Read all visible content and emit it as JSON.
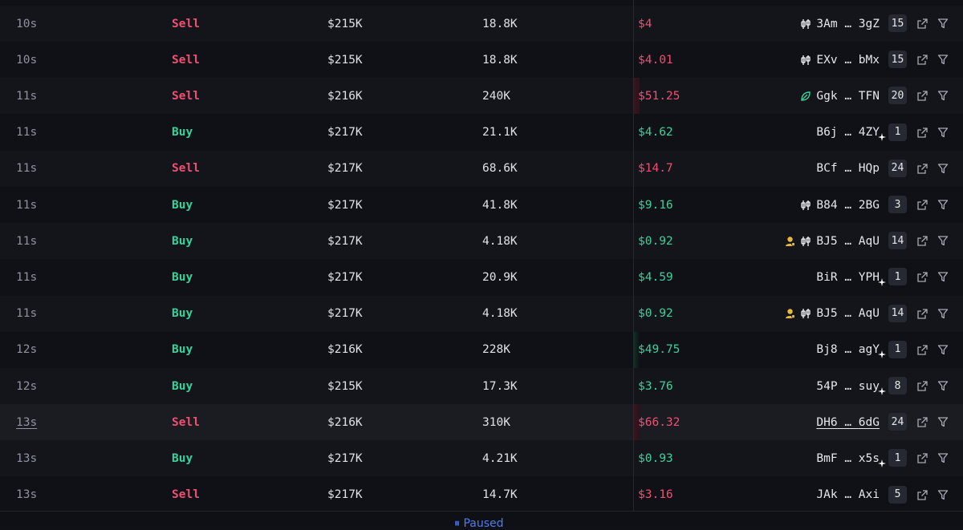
{
  "colors": {
    "buy": "#37d39b",
    "sell": "#ef4f72",
    "background": "#101116"
  },
  "rows": [
    {
      "age": "10s",
      "type": "Sell",
      "mc": "$215K",
      "amount": "18.8K",
      "total": "$4",
      "maker_prefix": "3Am",
      "maker_suffix": "3gZ",
      "count": "15",
      "icons": [
        "candle-icon"
      ],
      "bar": 0
    },
    {
      "age": "10s",
      "type": "Sell",
      "mc": "$215K",
      "amount": "18.8K",
      "total": "$4.01",
      "maker_prefix": "EXv",
      "maker_suffix": "bMx",
      "count": "15",
      "icons": [
        "candle-icon"
      ],
      "bar": 0
    },
    {
      "age": "11s",
      "type": "Sell",
      "mc": "$216K",
      "amount": "240K",
      "total": "$51.25",
      "maker_prefix": "Ggk",
      "maker_suffix": "TFN",
      "count": "20",
      "icons": [
        "leaf-icon"
      ],
      "bar": 0.011
    },
    {
      "age": "11s",
      "type": "Buy",
      "mc": "$217K",
      "amount": "21.1K",
      "total": "$4.62",
      "maker_prefix": "B6j",
      "maker_suffix": "4ZY",
      "count": "1",
      "icons": [
        "sparkle-icon"
      ],
      "bar": 0
    },
    {
      "age": "11s",
      "type": "Sell",
      "mc": "$217K",
      "amount": "68.6K",
      "total": "$14.7",
      "maker_prefix": "BCf",
      "maker_suffix": "HQp",
      "count": "24",
      "icons": [],
      "bar": 0
    },
    {
      "age": "11s",
      "type": "Buy",
      "mc": "$217K",
      "amount": "41.8K",
      "total": "$9.16",
      "maker_prefix": "B84",
      "maker_suffix": "2BG",
      "count": "3",
      "icons": [
        "candle-icon"
      ],
      "bar": 0
    },
    {
      "age": "11s",
      "type": "Buy",
      "mc": "$217K",
      "amount": "4.18K",
      "total": "$0.92",
      "maker_prefix": "BJ5",
      "maker_suffix": "AqU",
      "count": "14",
      "icons": [
        "user-icon",
        "candle-icon"
      ],
      "bar": 0
    },
    {
      "age": "11s",
      "type": "Buy",
      "mc": "$217K",
      "amount": "20.9K",
      "total": "$4.59",
      "maker_prefix": "BiR",
      "maker_suffix": "YPH",
      "count": "1",
      "icons": [
        "sparkle-icon"
      ],
      "bar": 0
    },
    {
      "age": "11s",
      "type": "Buy",
      "mc": "$217K",
      "amount": "4.18K",
      "total": "$0.92",
      "maker_prefix": "BJ5",
      "maker_suffix": "AqU",
      "count": "14",
      "icons": [
        "user-icon",
        "candle-icon"
      ],
      "bar": 0
    },
    {
      "age": "12s",
      "type": "Buy",
      "mc": "$216K",
      "amount": "228K",
      "total": "$49.75",
      "maker_prefix": "Bj8",
      "maker_suffix": "agY",
      "count": "1",
      "icons": [
        "sparkle-icon"
      ],
      "bar": 0.011
    },
    {
      "age": "12s",
      "type": "Buy",
      "mc": "$215K",
      "amount": "17.3K",
      "total": "$3.76",
      "maker_prefix": "54P",
      "maker_suffix": "suy",
      "count": "8",
      "icons": [
        "sparkle-icon"
      ],
      "bar": 0
    },
    {
      "age": "13s",
      "type": "Sell",
      "mc": "$216K",
      "amount": "310K",
      "total": "$66.32",
      "maker_prefix": "DH6",
      "maker_suffix": "6dG",
      "count": "24",
      "icons": [],
      "bar": 0.02,
      "highlight": true
    },
    {
      "age": "13s",
      "type": "Buy",
      "mc": "$217K",
      "amount": "4.21K",
      "total": "$0.93",
      "maker_prefix": "BmF",
      "maker_suffix": "x5s",
      "count": "1",
      "icons": [
        "sparkle-icon"
      ],
      "bar": 0
    },
    {
      "age": "13s",
      "type": "Sell",
      "mc": "$217K",
      "amount": "14.7K",
      "total": "$3.16",
      "maker_prefix": "JAk",
      "maker_suffix": "Axi",
      "count": "5",
      "icons": [],
      "bar": 0
    }
  ],
  "footer": {
    "paused_label": "Paused"
  }
}
